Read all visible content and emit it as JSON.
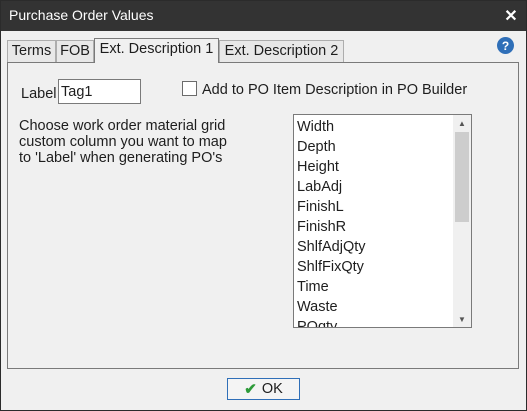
{
  "window": {
    "title": "Purchase Order Values",
    "close_glyph": "✕"
  },
  "help_glyph": "?",
  "tabs": [
    {
      "label": "Terms"
    },
    {
      "label": "FOB"
    },
    {
      "label": "Ext. Description 1",
      "active": true
    },
    {
      "label": "Ext. Description 2"
    }
  ],
  "form": {
    "label_caption": "Label",
    "label_value": "Tag1",
    "checkbox_label": "Add to PO Item Description in PO Builder",
    "checkbox_checked": false,
    "description_lines": [
      "Choose work order material grid",
      "custom column you want to map",
      "to 'Label' when generating PO's"
    ],
    "columns": [
      "Width",
      "Depth",
      "Height",
      "LabAdj",
      "FinishL",
      "FinishR",
      "ShlfAdjQty",
      "ShlfFixQty",
      "Time",
      "Waste",
      "POqty"
    ]
  },
  "ok_button": {
    "label": "OK",
    "icon": "checkmark-icon",
    "accent": "#2f6fb8",
    "icon_color": "#2e9b3a"
  },
  "colors": {
    "titlebar": "#333333",
    "help_icon": "#2f6fb8"
  }
}
